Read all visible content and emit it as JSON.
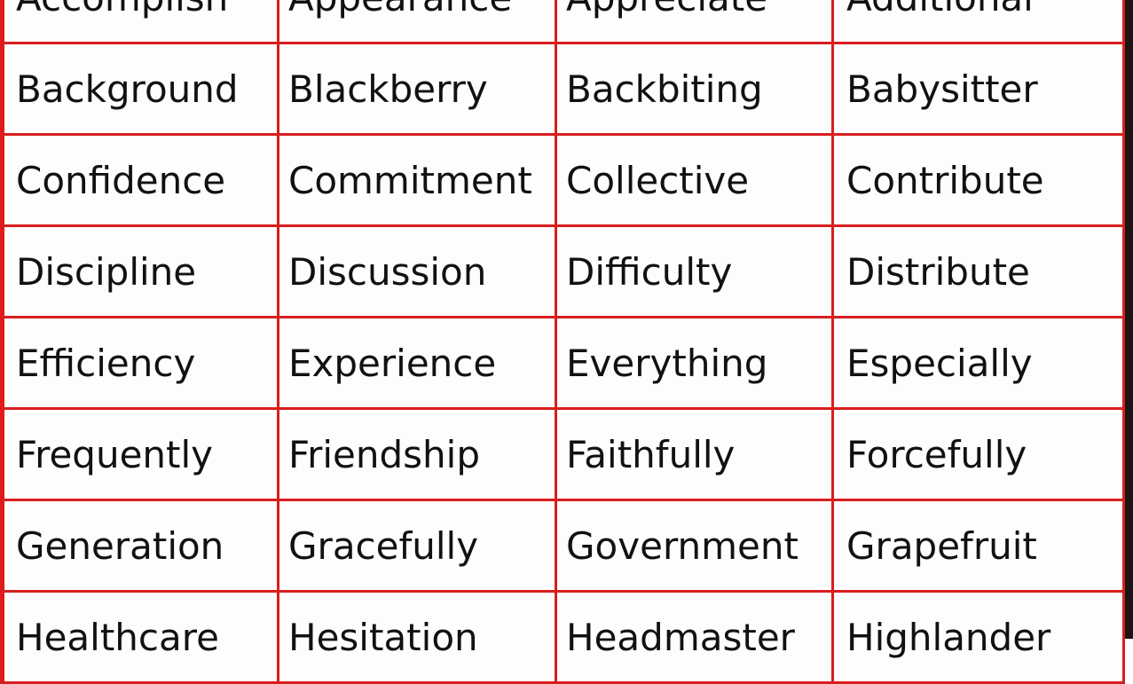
{
  "document": {
    "type": "word-table",
    "grid_color": "#d81e1e",
    "text_color": "#111111",
    "rows": [
      [
        "Accomplish",
        "Appearance",
        "Appreciate",
        "Additional"
      ],
      [
        "Background",
        "Blackberry",
        "Backbiting",
        "Babysitter"
      ],
      [
        "Confidence",
        "Commitment",
        "Collective",
        "Contribute"
      ],
      [
        "Discipline",
        "Discussion",
        "Difficulty",
        "Distribute"
      ],
      [
        "Efficiency",
        "Experience",
        "Everything",
        "Especially"
      ],
      [
        "Frequently",
        "Friendship",
        "Faithfully",
        "Forcefully"
      ],
      [
        "Generation",
        "Gracefully",
        "Government",
        "Grapefruit"
      ],
      [
        "Healthcare",
        "Hesitation",
        "Headmaster",
        "Highlander"
      ]
    ]
  }
}
